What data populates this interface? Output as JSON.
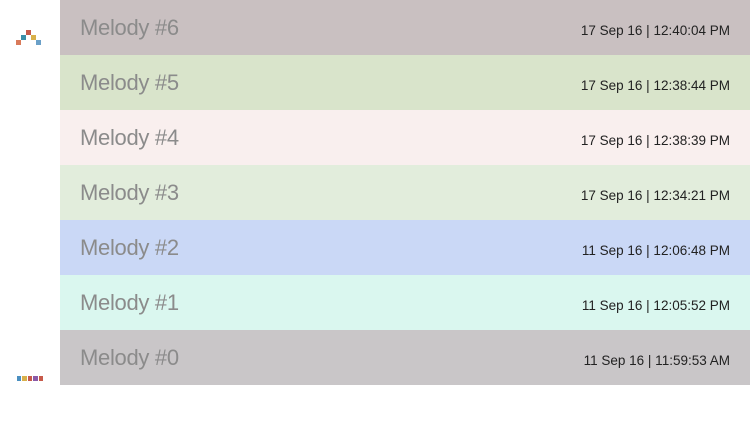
{
  "sidebar": {
    "logo_icon": "pixel-mosaic-logo",
    "logo_colors": [
      "#c75a4a",
      "#3c8fa8",
      "#d8b04a",
      "#d97a5a",
      "#6aa0c8"
    ],
    "dots_icon": "pixel-dots-menu-icon",
    "dots_colors": [
      "#4a8fc0",
      "#d8b04a",
      "#c75a4a",
      "#8a5aa8",
      "#c75a4a"
    ]
  },
  "melodies": [
    {
      "name": "Melody #6",
      "timestamp": "17 Sep 16 | 12:40:04 PM",
      "color": "#c9c0c1"
    },
    {
      "name": "Melody #5",
      "timestamp": "17 Sep 16 | 12:38:44 PM",
      "color": "#d9e4cb"
    },
    {
      "name": "Melody #4",
      "timestamp": "17 Sep 16 | 12:38:39 PM",
      "color": "#f9efee"
    },
    {
      "name": "Melody #3",
      "timestamp": "17 Sep 16 | 12:34:21 PM",
      "color": "#e2eddc"
    },
    {
      "name": "Melody #2",
      "timestamp": "11 Sep 16 | 12:06:48 PM",
      "color": "#cad8f6"
    },
    {
      "name": "Melody #1",
      "timestamp": "11 Sep 16 | 12:05:52 PM",
      "color": "#daf7ef"
    },
    {
      "name": "Melody #0",
      "timestamp": "11 Sep 16 | 11:59:53 AM",
      "color": "#c9c6c8"
    }
  ]
}
